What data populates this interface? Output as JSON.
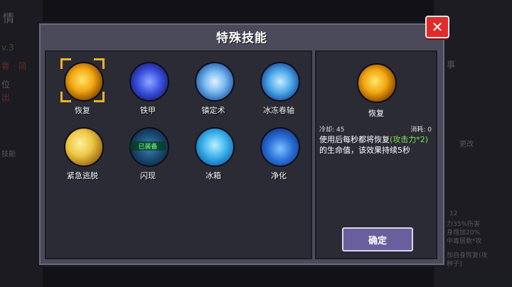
{
  "background": {
    "left_texts": [
      "情",
      "v.3",
      "鲁 · 简",
      "位",
      "出",
      "技能"
    ],
    "right_texts": [
      "事",
      "更改",
      "12",
      "力35%伤害",
      "身增加20%",
      "中毒层数*攻",
      "加自身恢复(攻",
      "种子]"
    ]
  },
  "dialog": {
    "title": "特殊技能",
    "close_symbol": "✕"
  },
  "skills": [
    {
      "label": "恢复",
      "icon": "restore-icon",
      "selected": true,
      "equipped": false
    },
    {
      "label": "铁甲",
      "icon": "armor-icon",
      "selected": false,
      "equipped": false
    },
    {
      "label": "镇定术",
      "icon": "stasis-icon",
      "selected": false,
      "equipped": false
    },
    {
      "label": "冰冻卷轴",
      "icon": "freeze-scroll-icon",
      "selected": false,
      "equipped": false
    },
    {
      "label": "紧急逃脱",
      "icon": "escape-icon",
      "selected": false,
      "equipped": false
    },
    {
      "label": "闪现",
      "icon": "flash-icon",
      "selected": false,
      "equipped": true
    },
    {
      "label": "冰箱",
      "icon": "ice-box-icon",
      "selected": false,
      "equipped": false
    },
    {
      "label": "净化",
      "icon": "purify-icon",
      "selected": false,
      "equipped": false
    }
  ],
  "equipped_badge": "已装备",
  "detail": {
    "name": "恢复",
    "cooldown": "冷却: 45",
    "cost": "消耗: 0",
    "desc_part1": "使用后每秒都将恢复",
    "desc_highlight": "(攻击力*2)",
    "desc_part2": "的生命值，该效果持续5秒",
    "confirm_label": "确定"
  },
  "colors": {
    "accent_selected": "#f0b12a",
    "close_red": "#e02b2b",
    "highlight_green": "#7ee84a",
    "button_purple": "#6a5e9c"
  }
}
